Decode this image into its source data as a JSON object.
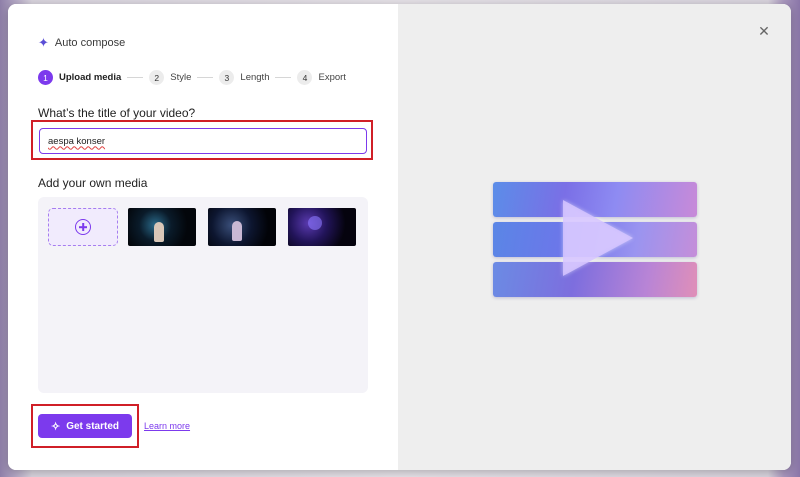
{
  "dialog": {
    "header": {
      "title": "Auto compose",
      "icon": "sparkle-icon"
    },
    "steps": [
      {
        "number": "1",
        "label": "Upload media",
        "active": true
      },
      {
        "number": "2",
        "label": "Style",
        "active": false
      },
      {
        "number": "3",
        "label": "Length",
        "active": false
      },
      {
        "number": "4",
        "label": "Export",
        "active": false
      }
    ],
    "title_question": "What’s the title of your video?",
    "title_input": {
      "value": "aespa konser",
      "placeholder": ""
    },
    "media_section_label": "Add your own media",
    "media_items": [
      {
        "type": "add",
        "icon": "plus-circle-icon"
      },
      {
        "type": "thumbnail"
      },
      {
        "type": "thumbnail"
      },
      {
        "type": "thumbnail"
      }
    ],
    "get_started_label": "Get started",
    "learn_more_label": "Learn more",
    "close_icon": "close-icon"
  },
  "colors": {
    "accent": "#7c3aed",
    "highlight_box": "#d01f27",
    "right_panel_bg": "#eeeeee"
  }
}
